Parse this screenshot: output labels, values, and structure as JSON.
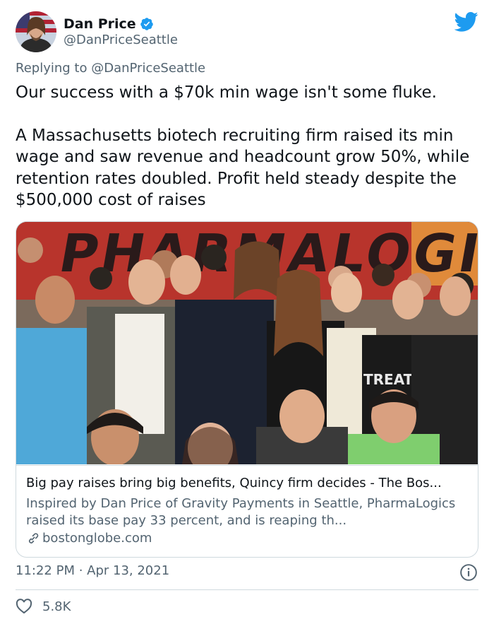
{
  "author": {
    "display_name": "Dan Price",
    "handle": "@DanPriceSeattle"
  },
  "reply": {
    "prefix": "Replying to ",
    "handle": "@DanPriceSeattle"
  },
  "tweet": {
    "paragraph_1": "Our success with a $70k min wage isn't some fluke.",
    "paragraph_2": "A Massachusetts biotech recruiting firm raised its min wage and saw revenue and headcount grow 50%, while retention rates doubled. Profit held steady despite the $500,000 cost of raises"
  },
  "card": {
    "image_banner_text": "PHARMALOGICS",
    "image_shirt_text": "TREAT",
    "title": "Big pay raises bring big benefits, Quincy firm decides - The Bos...",
    "description": "Inspired by Dan Price of Gravity Payments in Seattle, PharmaLogics raised its base pay 33 percent, and is reaping th...",
    "domain": "bostonglobe.com"
  },
  "meta": {
    "timestamp": "11:22 PM · Apr 13, 2021",
    "likes": "5.8K"
  },
  "colors": {
    "twitter_blue": "#1d9bf0",
    "text": "#0f1419",
    "secondary": "#536471",
    "border": "#cfd9de"
  },
  "icons": [
    "verified-badge-icon",
    "twitter-bird-icon",
    "link-icon",
    "info-icon",
    "heart-icon"
  ]
}
